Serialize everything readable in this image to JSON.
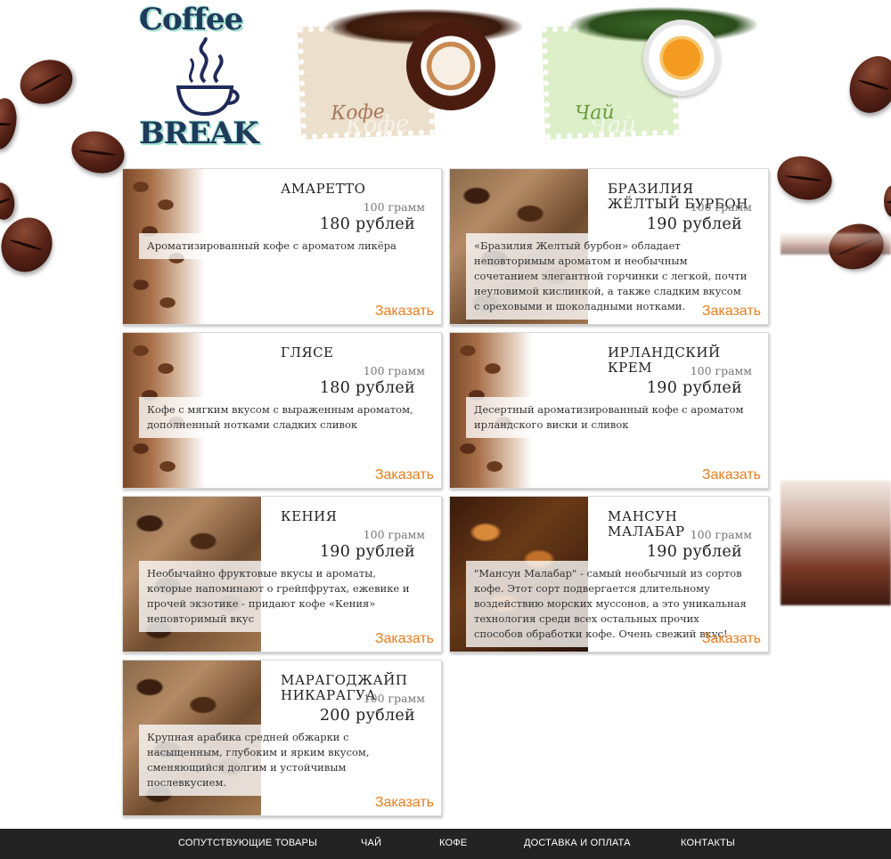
{
  "header": {
    "logo_top": "Coffee",
    "logo_bottom": "BREAK",
    "categories": [
      {
        "label": "Кофе",
        "ghost": "Кофе"
      },
      {
        "label": "Чай",
        "ghost": "Чай"
      }
    ]
  },
  "products": [
    {
      "title": "АМАРЕТТО",
      "weight": "100 грамм",
      "price": "180 рублей",
      "description": "Ароматизированный кофе с ароматом ликёра",
      "order_label": "Заказать"
    },
    {
      "title": "БРАЗИЛИЯ ЖЁЛТЫЙ БУРБОН",
      "weight": "100 грамм",
      "price": "190 рублей",
      "description": "«Бразилия Желтый бурбон» обладает неповторимым ароматом и необычным сочетанием элегантной горчинки с легкой, почти неуловимой кислинкой, а также сладким вкусом с ореховыми и шоколадными нотками.",
      "order_label": "Заказать"
    },
    {
      "title": "ГЛЯСЕ",
      "weight": "100 грамм",
      "price": "180 рублей",
      "description": "Кофе с мягким вкусом с выраженным ароматом, дополненный нотками сладких сливок",
      "order_label": "Заказать"
    },
    {
      "title": "ИРЛАНДСКИЙ КРЕМ",
      "weight": "100 грамм",
      "price": "190 рублей",
      "description": "Десертный ароматизированный кофе с ароматом ирландского виски и сливок",
      "order_label": "Заказать"
    },
    {
      "title": "КЕНИЯ",
      "weight": "100 грамм",
      "price": "190 рублей",
      "description": "Необычайно фруктовые вкусы и ароматы, которые напоминают о грейпфрутах, ежевике и прочей экзотике - придают кофе «Кения» неповторимый вкус",
      "order_label": "Заказать"
    },
    {
      "title": "МАНСУН МАЛАБАР",
      "weight": "100 грамм",
      "price": "190 рублей",
      "description": "\"Мансун Малабар\" - самый необычный из сортов кофе. Этот сорт подвергается длительному воздействию морских муссонов, а это уникальная технология среди всех остальных прочих способов обработки кофе. Очень свежий вкус!",
      "order_label": "Заказать"
    },
    {
      "title": "МАРАГОДЖАЙП НИКАРАГУА",
      "weight": "100 грамм",
      "price": "200 рублей",
      "description": "Крупная арабика средней обжарки с насыщенным, глубоким и ярким вкусом, сменяющийся долгим и устойчивым послевкусием.",
      "order_label": "Заказать"
    }
  ],
  "footer": {
    "nav": [
      "СОПУТСТВУЮЩИЕ ТОВАРЫ",
      "ЧАЙ",
      "КОФЕ",
      "ДОСТАВКА И ОПЛАТА",
      "КОНТАКТЫ"
    ]
  }
}
